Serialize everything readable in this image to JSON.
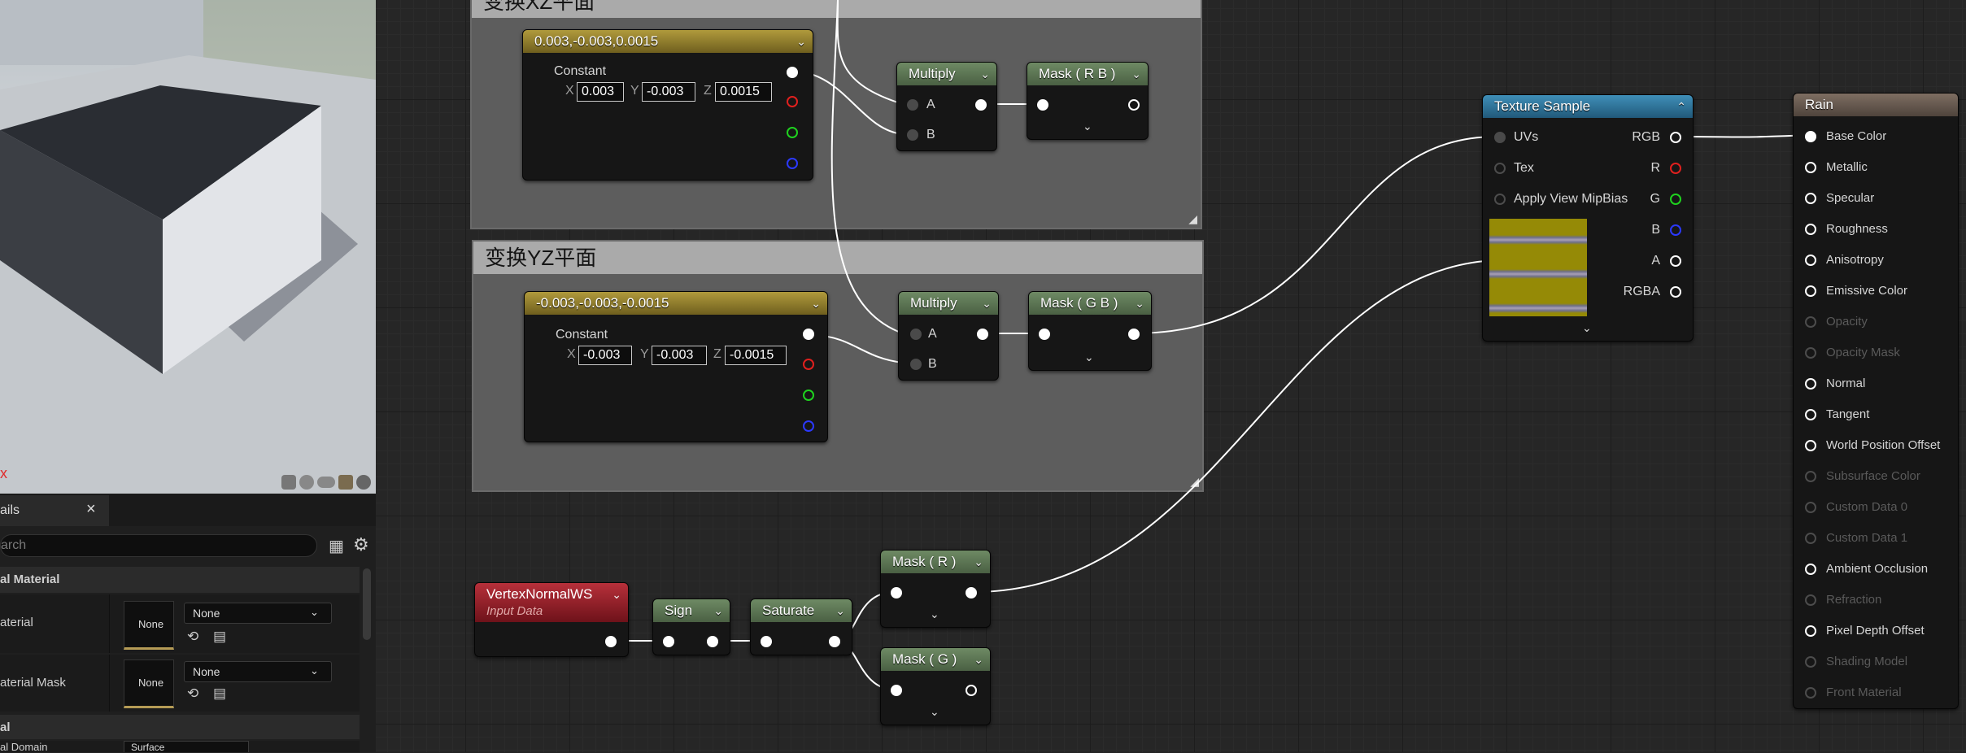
{
  "comment_boxes": [
    {
      "title": "变换XZ平面"
    },
    {
      "title": "变换YZ平面"
    }
  ],
  "nodes": {
    "const_xz": {
      "title": "0.003,-0.003,0.0015",
      "subtitle": "Constant",
      "x_label": "X",
      "x": "0.003",
      "y_label": "Y",
      "y": "-0.003",
      "z_label": "Z",
      "z": "0.0015"
    },
    "const_yz": {
      "title": "-0.003,-0.003,-0.0015",
      "subtitle": "Constant",
      "x_label": "X",
      "x": "-0.003",
      "y_label": "Y",
      "y": "-0.003",
      "z_label": "Z",
      "z": "-0.0015"
    },
    "multiply_1": {
      "title": "Multiply",
      "a": "A",
      "b": "B"
    },
    "multiply_2": {
      "title": "Multiply",
      "a": "A",
      "b": "B"
    },
    "mask_rb": {
      "title": "Mask ( R B )"
    },
    "mask_gb": {
      "title": "Mask ( G B )"
    },
    "texture_sample": {
      "title": "Texture Sample",
      "inputs": [
        "UVs",
        "Tex",
        "Apply View MipBias"
      ],
      "outputs": [
        "RGB",
        "R",
        "G",
        "B",
        "A",
        "RGBA"
      ]
    },
    "vertex_normal": {
      "title": "VertexNormalWS",
      "subtitle": "Input Data"
    },
    "sign": {
      "title": "Sign"
    },
    "saturate": {
      "title": "Saturate"
    },
    "mask_r": {
      "title": "Mask ( R )"
    },
    "mask_g": {
      "title": "Mask ( G )"
    },
    "rain": {
      "title": "Rain",
      "inputs": [
        {
          "label": "Base Color",
          "enabled": true
        },
        {
          "label": "Metallic",
          "enabled": true
        },
        {
          "label": "Specular",
          "enabled": true
        },
        {
          "label": "Roughness",
          "enabled": true
        },
        {
          "label": "Anisotropy",
          "enabled": true
        },
        {
          "label": "Emissive Color",
          "enabled": true
        },
        {
          "label": "Opacity",
          "enabled": false
        },
        {
          "label": "Opacity Mask",
          "enabled": false
        },
        {
          "label": "Normal",
          "enabled": true
        },
        {
          "label": "Tangent",
          "enabled": true
        },
        {
          "label": "World Position Offset",
          "enabled": true
        },
        {
          "label": "Subsurface Color",
          "enabled": false
        },
        {
          "label": "Custom Data 0",
          "enabled": false
        },
        {
          "label": "Custom Data 1",
          "enabled": false
        },
        {
          "label": "Ambient Occlusion",
          "enabled": true
        },
        {
          "label": "Refraction",
          "enabled": false
        },
        {
          "label": "Pixel Depth Offset",
          "enabled": true
        },
        {
          "label": "Shading Model",
          "enabled": false
        },
        {
          "label": "Front Material",
          "enabled": false
        }
      ]
    }
  },
  "details": {
    "tab_label": "ails",
    "search_placeholder": "arch",
    "section_1": "al Material",
    "row1_label": "aterial",
    "row1_thumb": "None",
    "row1_value": "None",
    "row2_label": "aterial Mask",
    "row2_thumb": "None",
    "row2_value": "None",
    "section_2": "al",
    "row3_label": "al Domain",
    "row3_value": "Surface"
  },
  "viewport": {
    "axis_letter": "x"
  },
  "colors": {
    "graph_bg": "#262626",
    "accent_gold": "#b09a3c",
    "accent_green": "#5c7a52",
    "accent_blue": "#2f7aa3"
  }
}
